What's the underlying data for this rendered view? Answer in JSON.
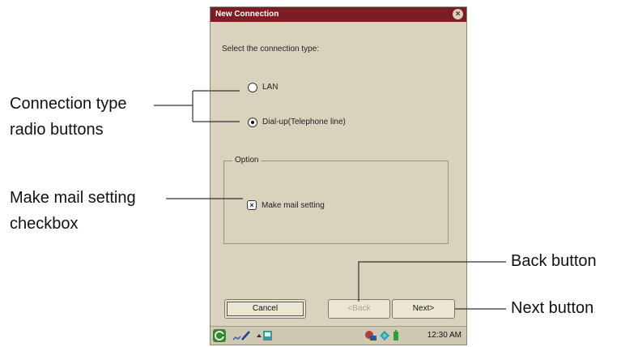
{
  "dialog": {
    "title": "New Connection",
    "close_glyph": "×",
    "prompt": "Select the connection type:",
    "options": [
      {
        "label": "LAN",
        "selected": false
      },
      {
        "label": "Dial-up(Telephone line)",
        "selected": true
      }
    ],
    "option_group": {
      "legend": "Option",
      "checkbox_label": "Make mail setting",
      "checked": true,
      "check_glyph": "×"
    },
    "buttons": {
      "cancel": "Cancel",
      "back": "<Back",
      "next": "Next>"
    }
  },
  "taskbar": {
    "clock": "12:30 AM",
    "icons": [
      "start-icon",
      "pen-icon",
      "keyboard-icon",
      "network-icon",
      "connection-icon",
      "battery-icon"
    ]
  },
  "callouts": {
    "radio": "Connection type\nradio buttons",
    "radio_line1": "Connection type",
    "radio_line2": "radio buttons",
    "check_line1": "Make mail setting",
    "check_line2": "checkbox",
    "back": "Back button",
    "next": "Next button"
  },
  "colors": {
    "titlebar": "#7a1e24",
    "dialog_bg": "#d9d3bd",
    "button_bg": "#ebe6d3",
    "disabled_text": "#a9a494"
  }
}
